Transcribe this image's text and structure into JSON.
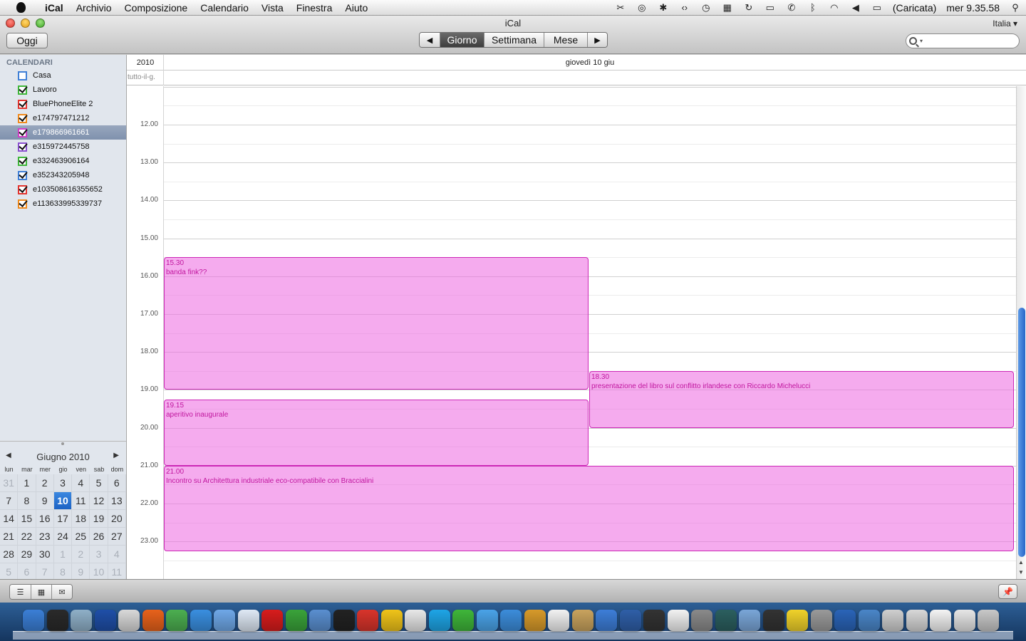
{
  "menubar": {
    "app": "iCal",
    "items": [
      "Archivio",
      "Composizione",
      "Calendario",
      "Vista",
      "Finestra",
      "Aiuto"
    ],
    "battery": "(Caricata)",
    "clock": "mer 9.35.58",
    "status_icons": [
      "scissors-icon",
      "script-icon",
      "paw-icon",
      "code-icon",
      "time-machine-icon",
      "spaces-icon",
      "sync-icon",
      "display-icon",
      "phone-icon",
      "bluetooth-icon",
      "wifi-icon",
      "volume-icon",
      "battery-icon"
    ]
  },
  "window": {
    "title": "iCal",
    "today_button": "Oggi",
    "views": {
      "day": "Giorno",
      "week": "Settimana",
      "month": "Mese"
    },
    "active_view": "Giorno",
    "region": "Italia ▾",
    "search": {
      "value": "",
      "placeholder": ""
    }
  },
  "sidebar": {
    "header": "CALENDARI",
    "calendars": [
      {
        "name": "Casa",
        "color": "#3f7fd6",
        "checked": false,
        "selected": false
      },
      {
        "name": "Lavoro",
        "color": "#3fb63a",
        "checked": true,
        "selected": false
      },
      {
        "name": "BluePhoneElite 2",
        "color": "#e3342f",
        "checked": true,
        "selected": false
      },
      {
        "name": "e174797471212",
        "color": "#f08a1c",
        "checked": true,
        "selected": false
      },
      {
        "name": "e179866961661",
        "color": "#d33fc8",
        "checked": true,
        "selected": true
      },
      {
        "name": "e315972445758",
        "color": "#8a4fd0",
        "checked": true,
        "selected": false
      },
      {
        "name": "e332463906164",
        "color": "#3fb63a",
        "checked": true,
        "selected": false
      },
      {
        "name": "e352343205948",
        "color": "#3f7fd6",
        "checked": true,
        "selected": false
      },
      {
        "name": "e103508616355652",
        "color": "#e3342f",
        "checked": true,
        "selected": false
      },
      {
        "name": "e113633995339737",
        "color": "#f08a1c",
        "checked": true,
        "selected": false
      }
    ]
  },
  "minical": {
    "title": "Giugno 2010",
    "weekdays": [
      "lun",
      "mar",
      "mer",
      "gio",
      "ven",
      "sab",
      "dom"
    ],
    "weeks": [
      [
        "31",
        "1",
        "2",
        "3",
        "4",
        "5",
        "6"
      ],
      [
        "7",
        "8",
        "9",
        "10",
        "11",
        "12",
        "13"
      ],
      [
        "14",
        "15",
        "16",
        "17",
        "18",
        "19",
        "20"
      ],
      [
        "21",
        "22",
        "23",
        "24",
        "25",
        "26",
        "27"
      ],
      [
        "28",
        "29",
        "30",
        "1",
        "2",
        "3",
        "4"
      ],
      [
        "5",
        "6",
        "7",
        "8",
        "9",
        "10",
        "11"
      ]
    ],
    "today": "10"
  },
  "dayview": {
    "year": "2010",
    "date": "giovedì 10 giu",
    "allday_label": "tutto-il-g.",
    "hours": [
      "12.00",
      "13.00",
      "14.00",
      "15.00",
      "16.00",
      "17.00",
      "18.00",
      "19.00",
      "20.00",
      "21.00",
      "22.00",
      "23.00"
    ],
    "events": [
      {
        "time": "15.30",
        "title": "banda fink??",
        "start": 15.5,
        "end": 19.0,
        "col": 0,
        "span": 1
      },
      {
        "time": "18.30",
        "title": "presentazione del libro sul conflitto irlandese con Riccardo Michelucci",
        "start": 18.5,
        "end": 20.0,
        "col": 1,
        "span": 1
      },
      {
        "time": "19.15",
        "title": "aperitivo inaugurale",
        "start": 19.25,
        "end": 21.0,
        "col": 0,
        "span": 1
      },
      {
        "time": "21.00",
        "title": "Incontro su Architettura industriale eco-compatibile con Braccialini",
        "start": 21.0,
        "end": 23.25,
        "col": 0,
        "span": 2
      }
    ]
  },
  "dock": {
    "icons": [
      {
        "name": "finder-icon",
        "color": "#3b7fd6"
      },
      {
        "name": "dashboard-icon",
        "color": "#2a2a2a"
      },
      {
        "name": "hand-app-icon",
        "color": "#8fb0c8"
      },
      {
        "name": "google-earth-icon",
        "color": "#1f4fa8"
      },
      {
        "name": "mail-icon",
        "color": "#d9d9d9"
      },
      {
        "name": "firefox-icon",
        "color": "#e8621b"
      },
      {
        "name": "chrome-icon",
        "color": "#4caf50"
      },
      {
        "name": "safari-icon",
        "color": "#3a8fe0"
      },
      {
        "name": "network-icon",
        "color": "#6fa8e8"
      },
      {
        "name": "adium-icon",
        "color": "#dfe9f5"
      },
      {
        "name": "opera-icon",
        "color": "#d81c1c"
      },
      {
        "name": "globe-icon",
        "color": "#3aa33a"
      },
      {
        "name": "phone-sync-icon",
        "color": "#5a8fd0"
      },
      {
        "name": "iphone-icon",
        "color": "#222222"
      },
      {
        "name": "home-app-icon",
        "color": "#d9342b"
      },
      {
        "name": "picasa-icon",
        "color": "#f0c419"
      },
      {
        "name": "flickr-uploader-icon",
        "color": "#e8e8e8"
      },
      {
        "name": "skype-icon",
        "color": "#1ea5e6"
      },
      {
        "name": "upload-icon",
        "color": "#3fb63a"
      },
      {
        "name": "messenger-icon",
        "color": "#4aa3e8"
      },
      {
        "name": "itunes-icon",
        "color": "#3c8ddb"
      },
      {
        "name": "iphoto-icon",
        "color": "#d79a2a"
      },
      {
        "name": "ical-icon",
        "color": "#f2f2f2"
      },
      {
        "name": "address-book-icon",
        "color": "#c9a35e"
      },
      {
        "name": "ff-app-icon",
        "color": "#3d7ed8"
      },
      {
        "name": "quicktime-icon",
        "color": "#2f5fa8"
      },
      {
        "name": "ustream-icon",
        "color": "#333333"
      },
      {
        "name": "textedit-icon",
        "color": "#f2f2f2"
      },
      {
        "name": "sync-app-icon",
        "color": "#8a8a8a"
      },
      {
        "name": "time-machine-icon",
        "color": "#2b5f5f"
      },
      {
        "name": "preview-icon",
        "color": "#7aa6d8"
      },
      {
        "name": "chess-icon",
        "color": "#333333"
      },
      {
        "name": "grid-app-icon",
        "color": "#f0d22a"
      },
      {
        "name": "photo-app-icon",
        "color": "#9a9a9a"
      },
      {
        "name": "home-sync-icon",
        "color": "#2a64b8"
      },
      {
        "name": "folder-icon",
        "color": "#4a86c8"
      },
      {
        "name": "network-utility-icon",
        "color": "#cfcfcf"
      },
      {
        "name": "link-icon",
        "color": "#d8d8d8"
      },
      {
        "name": "document-icon",
        "color": "#f4f4f4"
      },
      {
        "name": "pdf-icon",
        "color": "#e6e6e6"
      },
      {
        "name": "trash-icon",
        "color": "#c8c8c8"
      }
    ]
  }
}
